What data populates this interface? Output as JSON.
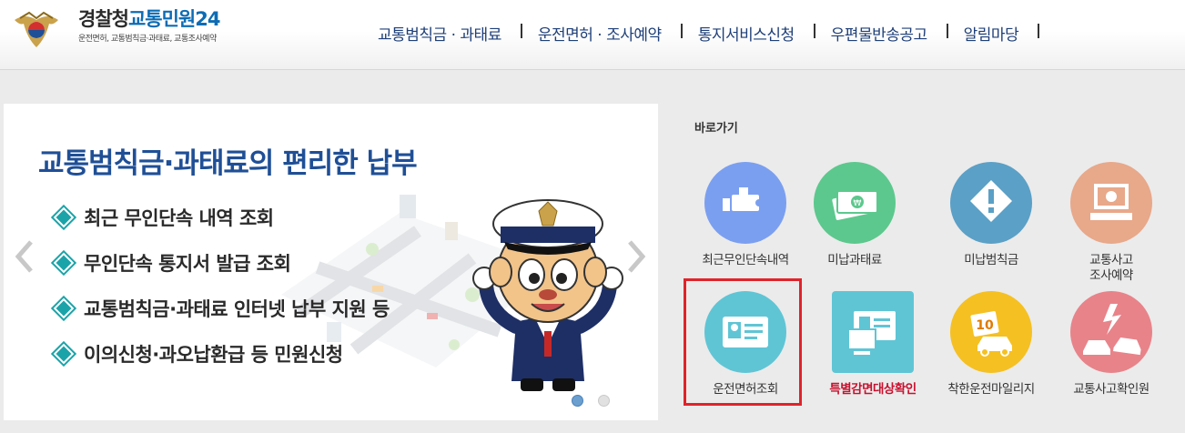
{
  "header": {
    "brand": {
      "org_name": "경찰청",
      "service_name": "교통민원24",
      "subtitle": "운전면허, 교통범칙금·과태료, 교통조사예약"
    },
    "nav": [
      {
        "label": "교통범칙금 · 과태료"
      },
      {
        "label": "운전면허 · 조사예약"
      },
      {
        "label": "통지서비스신청"
      },
      {
        "label": "우편물반송공고"
      },
      {
        "label": "알림마당"
      }
    ]
  },
  "banner": {
    "title": "교통범칙금·과태료의 편리한 납부",
    "features": [
      "최근 무인단속 내역 조회",
      "무인단속 통지서 발급 조회",
      "교통범칙금·과태료 인터넷 납부 지원 등",
      "이의신청·과오납환급 등 민원신청"
    ],
    "slide_count": 2,
    "active_slide": 1
  },
  "quick_links": {
    "title": "바로가기",
    "items": [
      {
        "label": "최근무인단속내역",
        "icon": "cctv-camera-icon",
        "color": "#7b9ff0"
      },
      {
        "label": "미납과태료",
        "icon": "money-bills-icon",
        "color": "#5cc88d"
      },
      {
        "label": "미납범칙금",
        "icon": "warning-diamond-icon",
        "color": "#5ba0c6"
      },
      {
        "label": "교통사고\n조사예약",
        "icon": "computer-monitor-icon",
        "color": "#e8a88a"
      },
      {
        "label": "운전면허조회",
        "icon": "license-card-icon",
        "color": "#5fc5d5",
        "highlighted": true
      },
      {
        "label": "특별감면대상확인",
        "icon": "license-monitor-icon",
        "color": "#5fc5d5",
        "emphasis": true
      },
      {
        "label": "착한운전마일리지",
        "icon": "mileage-car-icon",
        "color": "#f5c022"
      },
      {
        "label": "교통사고확인원",
        "icon": "car-crash-icon",
        "color": "#e8838a"
      }
    ]
  },
  "colors": {
    "nav_text": "#1e3f78",
    "banner_title": "#1f4f96",
    "highlight_border": "#e0222a",
    "special_label": "#c8102e"
  }
}
